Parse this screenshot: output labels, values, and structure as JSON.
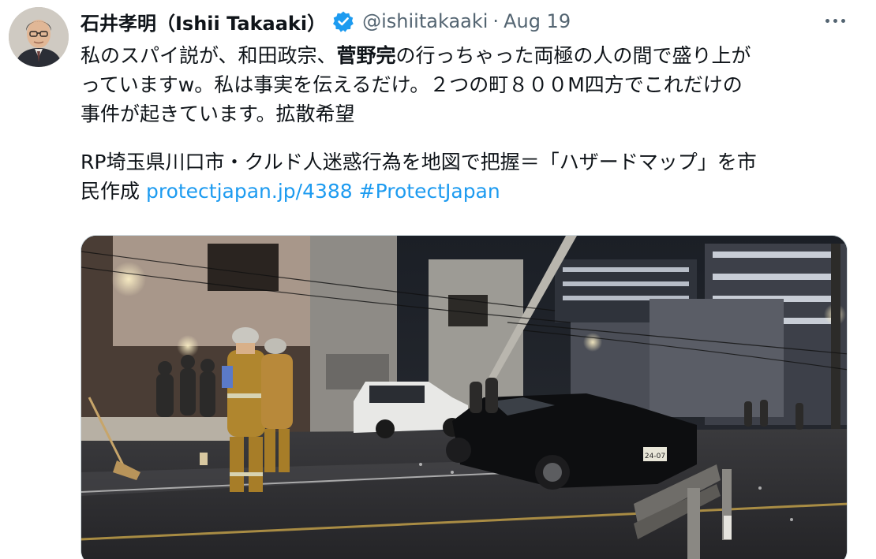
{
  "tweet": {
    "display_name": "石井孝明（Ishii Takaaki）",
    "handle": "@ishiitakaaki",
    "separator": "·",
    "date": "Aug 19",
    "verified_icon": "verified-badge-icon",
    "more_icon": "more-options-icon",
    "body": {
      "line1_before": "私のスパイ説が、和田政宗、",
      "line1_bold": "菅野完",
      "line1_after": "の行っちゃった両極の人の間で盛り上が",
      "line2": "っていますw。私は事実を伝えるだけ。２つの町８００M四方でこれだけの",
      "line3": "事件が起きています。拡散希望",
      "line4": "RP埼玉県川口市・クルド人迷惑行為を地図で把握＝「ハザードマップ」を市",
      "line5_text": "民作成",
      "link_url": "protectjapan.jp/4388",
      "hashtag": "#ProtectJapan"
    },
    "media": {
      "license_plate": "24-07"
    }
  },
  "colors": {
    "link": "#1d9bf0",
    "secondary_text": "#536471",
    "verified": "#1d9bf0"
  }
}
